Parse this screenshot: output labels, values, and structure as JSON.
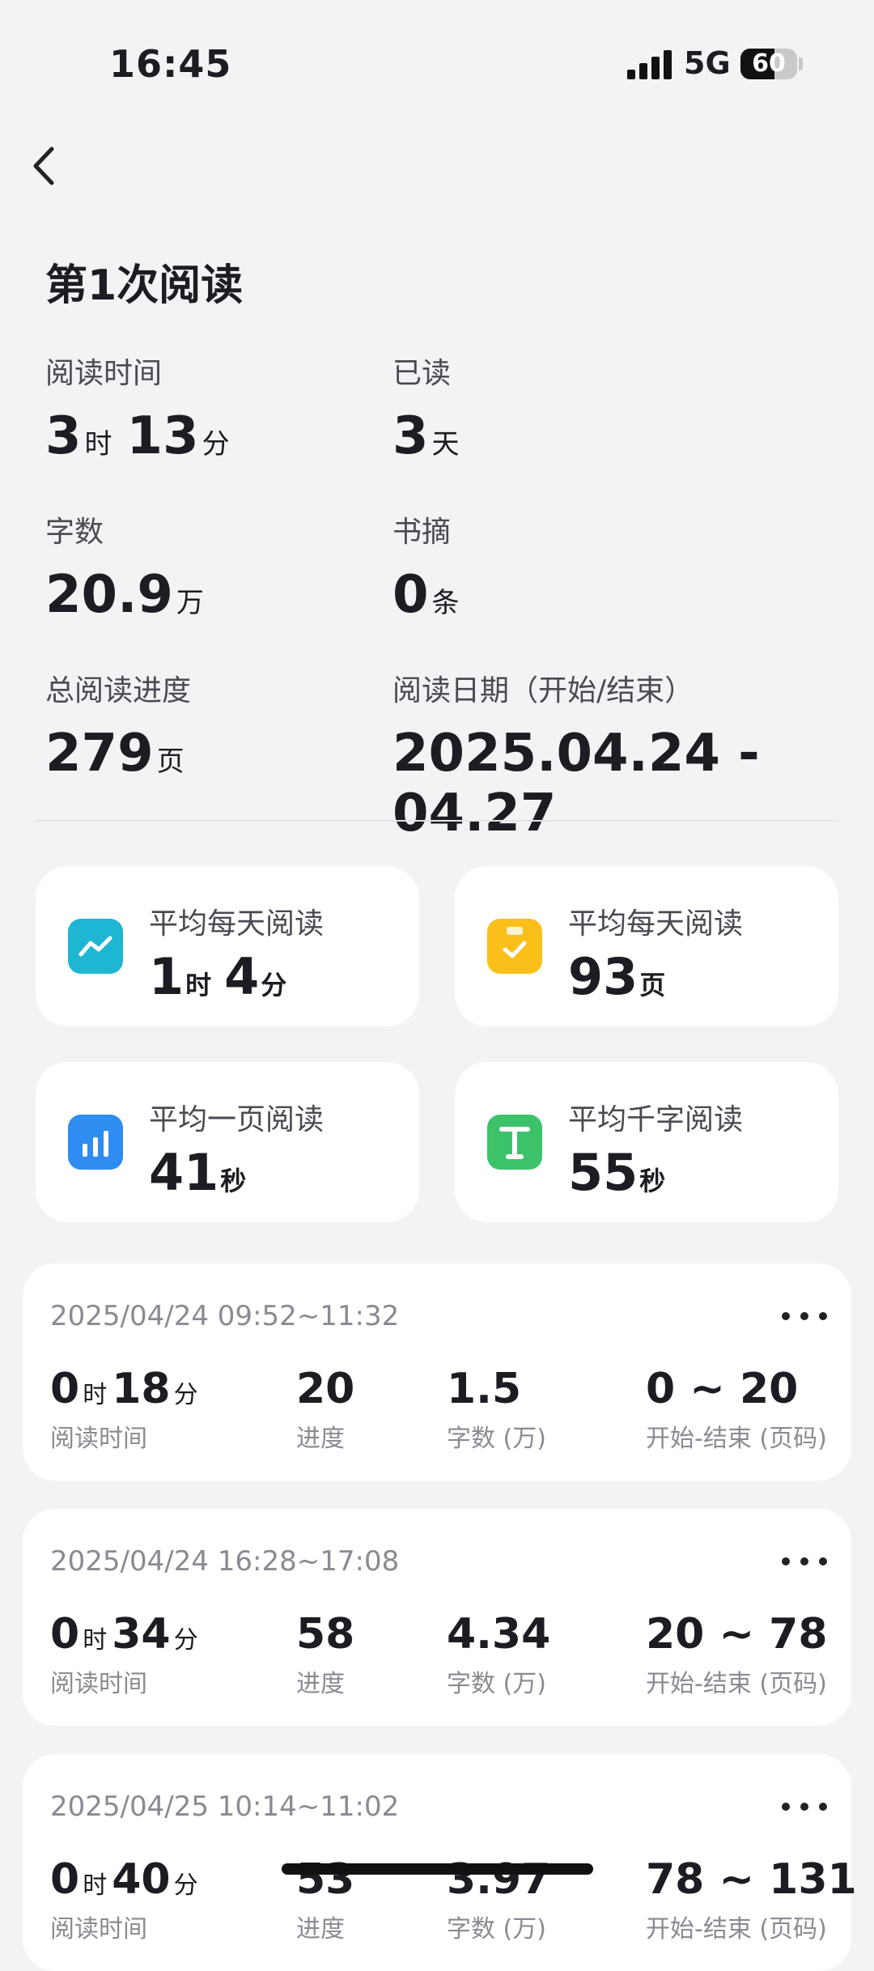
{
  "status_bar": {
    "time": "16:45",
    "network": "5G",
    "battery": "60",
    "battery_level": 0.6
  },
  "page": {
    "title": "第1次阅读"
  },
  "stats": [
    {
      "label": "阅读时间",
      "parts": [
        {
          "v": "3",
          "u": "时"
        },
        {
          "v": "13",
          "u": "分"
        }
      ]
    },
    {
      "label": "已读",
      "parts": [
        {
          "v": "3",
          "u": "天"
        }
      ]
    },
    {
      "label": "字数",
      "parts": [
        {
          "v": "20.9",
          "u": "万"
        }
      ]
    },
    {
      "label": "书摘",
      "parts": [
        {
          "v": "0",
          "u": "条"
        }
      ]
    },
    {
      "label": "总阅读进度",
      "parts": [
        {
          "v": "279",
          "u": "页"
        }
      ]
    },
    {
      "label": "阅读日期（开始/结束）",
      "parts": [
        {
          "v": "2025.04.24 - 04.27",
          "u": ""
        }
      ]
    }
  ],
  "cards": [
    {
      "label": "平均每天阅读",
      "parts": [
        {
          "v": "1",
          "u": "时"
        },
        {
          "v": "4",
          "u": "分"
        }
      ],
      "icon": "trend-chart-icon",
      "color": "#1fb6d4"
    },
    {
      "label": "平均每天阅读",
      "parts": [
        {
          "v": "93",
          "u": "页"
        }
      ],
      "icon": "clipboard-check-icon",
      "color": "#fbbf1a"
    },
    {
      "label": "平均一页阅读",
      "parts": [
        {
          "v": "41",
          "u": "秒"
        }
      ],
      "icon": "bar-chart-icon",
      "color": "#2f8cf0"
    },
    {
      "label": "平均千字阅读",
      "parts": [
        {
          "v": "55",
          "u": "秒"
        }
      ],
      "icon": "text-t-icon",
      "color": "#3cc36a"
    }
  ],
  "record_labels": {
    "time": "阅读时间",
    "progress": "进度",
    "words": "字数 (万)",
    "range": "开始-结束 (页码)"
  },
  "records": [
    {
      "date": "2025/04/24 09:52~11:32",
      "h": "0",
      "hu": "时",
      "m": "18",
      "mu": "分",
      "progress": "20",
      "words": "1.5",
      "range": "0 ~ 20"
    },
    {
      "date": "2025/04/24 16:28~17:08",
      "h": "0",
      "hu": "时",
      "m": "34",
      "mu": "分",
      "progress": "58",
      "words": "4.34",
      "range": "20 ~ 78"
    },
    {
      "date": "2025/04/25 10:14~11:02",
      "h": "0",
      "hu": "时",
      "m": "40",
      "mu": "分",
      "progress": "53",
      "words": "3.97",
      "range": "78 ~ 131"
    }
  ],
  "colors": {
    "background": "#f3f3f5",
    "card": "#ffffff",
    "text": "#1c1c22",
    "muted": "#8a8a92"
  }
}
